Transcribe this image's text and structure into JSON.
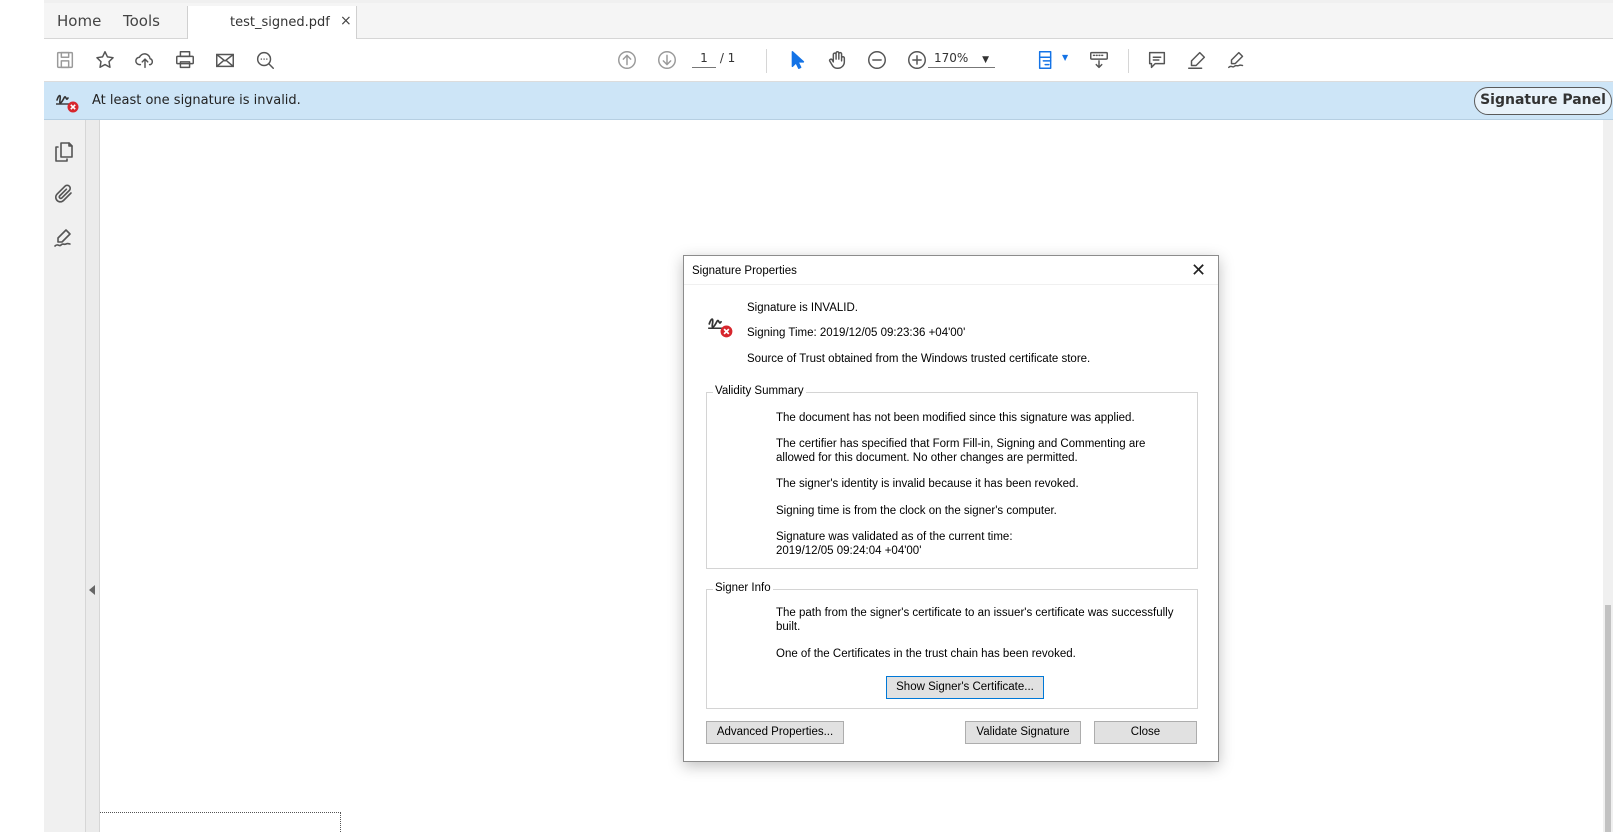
{
  "tabs": {
    "home": "Home",
    "tools": "Tools",
    "document": "test_signed.pdf",
    "close_glyph": "×"
  },
  "toolbar": {
    "page_current": "1",
    "page_total": "/ 1",
    "zoom": "170%"
  },
  "infobar": {
    "message": "At least one signature is invalid.",
    "signature_panel_label": "Signature Panel",
    "background": "#cde5f7"
  },
  "dialog": {
    "title": "Signature Properties",
    "close_glyph": "✕",
    "status": "Signature is INVALID.",
    "signing_time": "Signing Time:  2019/12/05 09:23:36 +04'00'",
    "trust_source": "Source of Trust obtained from the Windows trusted certificate store.",
    "validity": {
      "legend": "Validity Summary",
      "lines": [
        "The document has not been modified since this signature was applied.",
        "The certifier has specified that Form Fill-in, Signing and Commenting are allowed for this document. No other changes are permitted.",
        "The signer's identity is invalid because it has been revoked.",
        "Signing time is from the clock on the signer's computer.",
        "Signature was validated as of the current time: 2019/12/05 09:24:04 +04'00'"
      ]
    },
    "signer_info": {
      "legend": "Signer Info",
      "lines": [
        "The path from the signer's certificate to an issuer's certificate was successfully built.",
        "One of the Certificates in the trust chain has been revoked."
      ],
      "show_certificate_button": "Show Signer's Certificate..."
    },
    "buttons": {
      "advanced": "Advanced Properties...",
      "validate": "Validate Signature",
      "close": "Close"
    }
  },
  "icons": {
    "save": "save-icon",
    "bookmark": "star-icon",
    "upload": "cloud-upload-icon",
    "print": "printer-icon",
    "email": "envelope-icon",
    "search": "search-icon",
    "prev_page": "arrow-up-circle-icon",
    "next_page": "arrow-down-circle-icon",
    "select": "cursor-icon",
    "hand": "hand-icon",
    "zoom_out": "zoom-out-icon",
    "zoom_in": "zoom-in-icon",
    "fit_page": "fit-page-icon",
    "scroll_mode": "scroll-mode-icon",
    "comment": "comment-icon",
    "highlight": "pen-icon",
    "sign": "sign-icon"
  },
  "colors": {
    "accent_blue": "#1473e6",
    "error_red": "#d7262d",
    "focus_border": "#0078d7"
  }
}
